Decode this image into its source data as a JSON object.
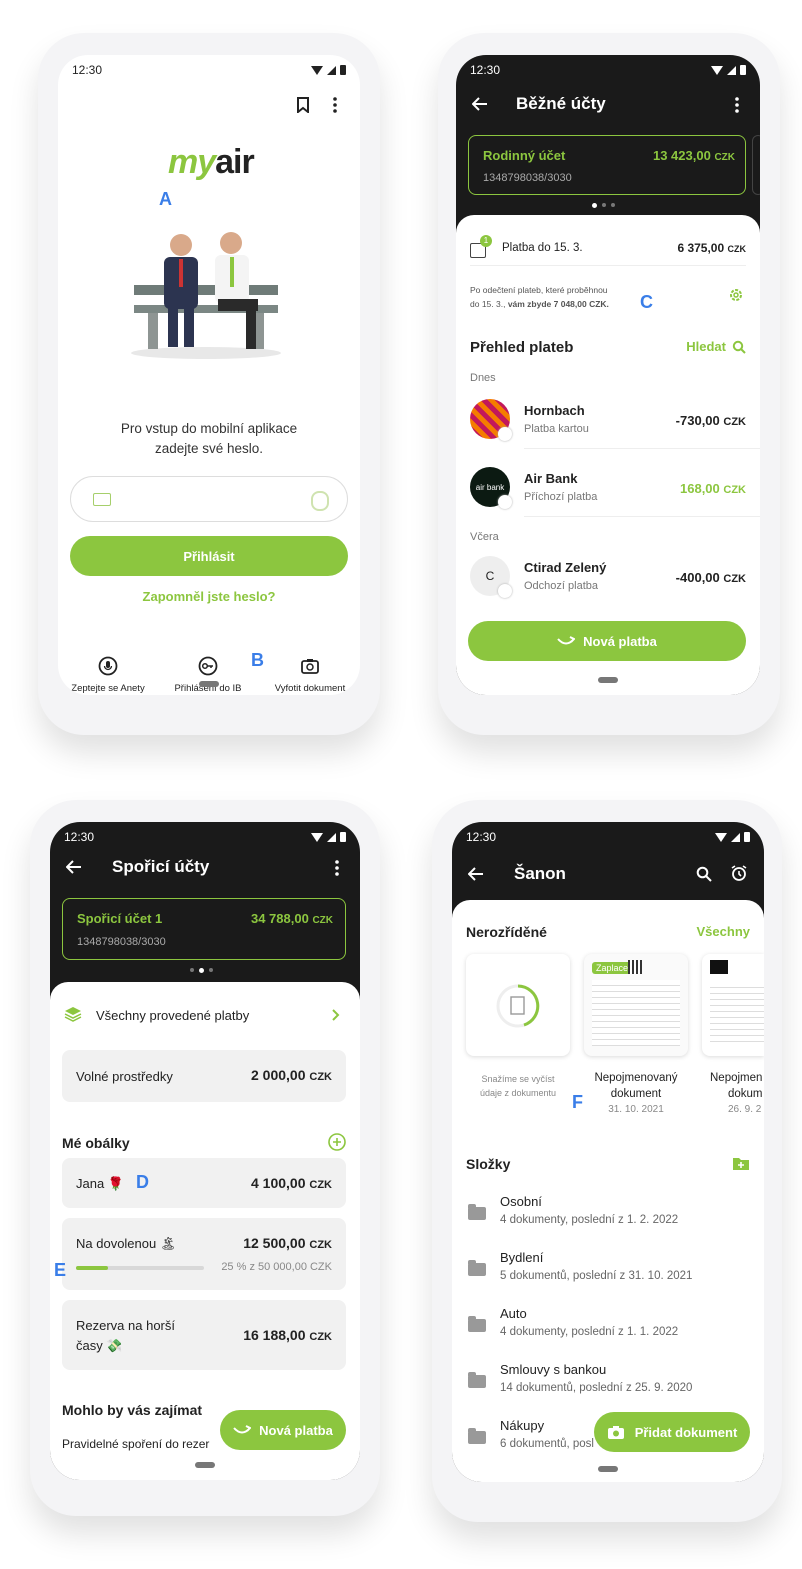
{
  "status": {
    "time": "12:30"
  },
  "s1": {
    "logo_my": "my",
    "logo_air": "air",
    "marker_a": "A",
    "marker_b": "B",
    "prompt_line1": "Pro vstup do mobilní aplikace",
    "prompt_line2": "zadejte své heslo.",
    "login_button": "Přihlásit",
    "forgot": "Zapomněl jste heslo?",
    "actions": [
      {
        "label": "Zeptejte se Anety",
        "icon": "microphone-icon"
      },
      {
        "label": "Přihlášení do IB",
        "icon": "key-icon"
      },
      {
        "label": "Vyfotit dokument",
        "icon": "camera-icon"
      }
    ]
  },
  "s2": {
    "title": "Běžné účty",
    "account_name": "Rodinný účet",
    "account_amount": "13 423,00",
    "currency": "CZK",
    "account_number": "1348798038/3030",
    "due_label": "Platba do 15. 3.",
    "due_amount": "6 375,00",
    "due_badge": "1",
    "notice_line1": "Po odečtení plateb, které proběhnou",
    "notice_line2_a": "do 15. 3., ",
    "notice_line2_b": "vám zbyde 7 048,00 CZK.",
    "marker_c": "C",
    "overview_title": "Přehled plateb",
    "search_label": "Hledat",
    "today": "Dnes",
    "yesterday": "Včera",
    "payments": [
      {
        "name": "Hornbach",
        "type": "Platba kartou",
        "amount": "-730,00",
        "color": "#222"
      },
      {
        "name": "Air Bank",
        "type": "Příchozí platba",
        "amount": "168,00",
        "color": "#8cc63f"
      },
      {
        "name": "Ctirad Zelený",
        "type": "Odchozí platba",
        "amount": "-400,00",
        "color": "#222",
        "initial": "C"
      }
    ],
    "airbank_logo": "air bank",
    "new_payment": "Nová platba"
  },
  "s3": {
    "title": "Spořicí účty",
    "account_name": "Spořicí účet 1",
    "account_amount": "34 788,00",
    "account_number": "1348798038/3030",
    "all_payments": "Všechny provedené platby",
    "free_funds_label": "Volné prostředky",
    "free_funds_amount": "2 000,00",
    "envelopes_title": "Mé obálky",
    "env1_label": "Jana 🌹",
    "env1_amount": "4 100,00",
    "marker_d": "D",
    "env2_label": "Na dovolenou 🏝",
    "env2_amount": "12 500,00",
    "env2_progress_text": "25 % z 50 000,00 CZK",
    "env2_progress": 0.25,
    "marker_e": "E",
    "env3_line1": "Rezerva na horší",
    "env3_line2": "časy 💸",
    "env3_amount": "16 188,00",
    "interest_title": "Mohlo by vás zajímat",
    "interest_item": "Pravidelné spoření do rezer",
    "new_payment": "Nová platba"
  },
  "s4": {
    "title": "Šanon",
    "unsorted_title": "Nerozříděné",
    "all_link": "Všechny",
    "doc0_caption_1": "Snažíme se vyčíst",
    "doc0_caption_2": "údaje z dokumentu",
    "doc1_badge": "Zaplaceno",
    "doc1_name_1": "Nepojmenovaný",
    "doc1_name_2": "dokument",
    "doc1_date": "31. 10. 2021",
    "doc2_name_1": "Nepojmen",
    "doc2_name_2": "dokum",
    "doc2_date": "26. 9. 2",
    "marker_f": "F",
    "folders_title": "Složky",
    "folders": [
      {
        "name": "Osobní",
        "info": "4 dokumenty, poslední z 1. 2. 2022"
      },
      {
        "name": "Bydlení",
        "info": "5 dokumentů, poslední z 31. 10. 2021"
      },
      {
        "name": "Auto",
        "info": "4 dokumenty, poslední z 1. 1. 2022"
      },
      {
        "name": "Smlouvy s bankou",
        "info": "14 dokumentů, poslední z 25. 9. 2020"
      },
      {
        "name": "Nákupy",
        "info": "6 dokumentů, posl"
      }
    ],
    "add_document": "Přidat dokument"
  }
}
